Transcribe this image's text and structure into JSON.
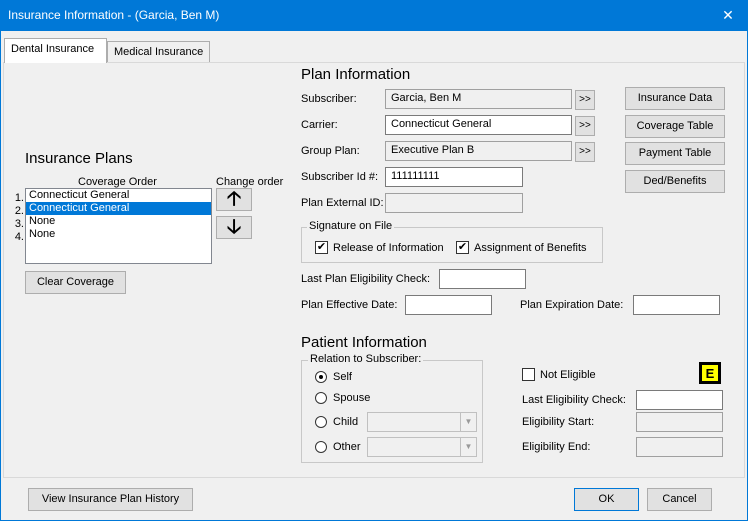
{
  "window": {
    "title": "Insurance Information - (Garcia, Ben M)"
  },
  "tabs": [
    "Dental Insurance",
    "Medical Insurance"
  ],
  "insurance_plans": {
    "title": "Insurance Plans",
    "coverage_order_label": "Coverage Order",
    "change_order_label": "Change order",
    "items": [
      "Connecticut General",
      "Connecticut General",
      "None",
      "None"
    ],
    "numbers": [
      "1.",
      "2.",
      "3.",
      "4."
    ],
    "clear_button": "Clear Coverage"
  },
  "plan_info": {
    "title": "Plan Information",
    "subscriber_label": "Subscriber:",
    "subscriber_value": "Garcia, Ben M",
    "carrier_label": "Carrier:",
    "carrier_value": "Connecticut General",
    "group_plan_label": "Group Plan:",
    "group_plan_value": "Executive Plan B",
    "subscriber_id_label": "Subscriber Id #:",
    "subscriber_id_value": "111111111",
    "plan_external_id_label": "Plan External ID:",
    "plan_external_id_value": "",
    "more_button": ">>",
    "signature_title": "Signature on File",
    "release_label": "Release of Information",
    "assignment_label": "Assignment of Benefits",
    "last_eligibility_label": "Last Plan Eligibility Check:",
    "effective_date_label": "Plan Effective Date:",
    "expiration_date_label": "Plan Expiration Date:"
  },
  "side_buttons": [
    "Insurance Data",
    "Coverage Table",
    "Payment Table",
    "Ded/Benefits"
  ],
  "patient_info": {
    "title": "Patient Information",
    "relation_title": "Relation to Subscriber:",
    "self_label": "Self",
    "spouse_label": "Spouse",
    "child_label": "Child",
    "other_label": "Other",
    "not_eligible_label": "Not Eligible",
    "last_eligibility_check_label": "Last Eligibility Check:",
    "eligibility_start_label": "Eligibility Start:",
    "eligibility_end_label": "Eligibility End:",
    "e_button": "E"
  },
  "footer": {
    "history_button": "View Insurance Plan History",
    "ok_button": "OK",
    "cancel_button": "Cancel"
  },
  "icons": {
    "close": "close-icon",
    "up": "arrow-up-icon",
    "down": "arrow-down-icon",
    "check": "checkmark-icon"
  },
  "colors": {
    "titlebar": "#0078d7",
    "selection": "#0078d7",
    "e_button": "#ffff00"
  }
}
